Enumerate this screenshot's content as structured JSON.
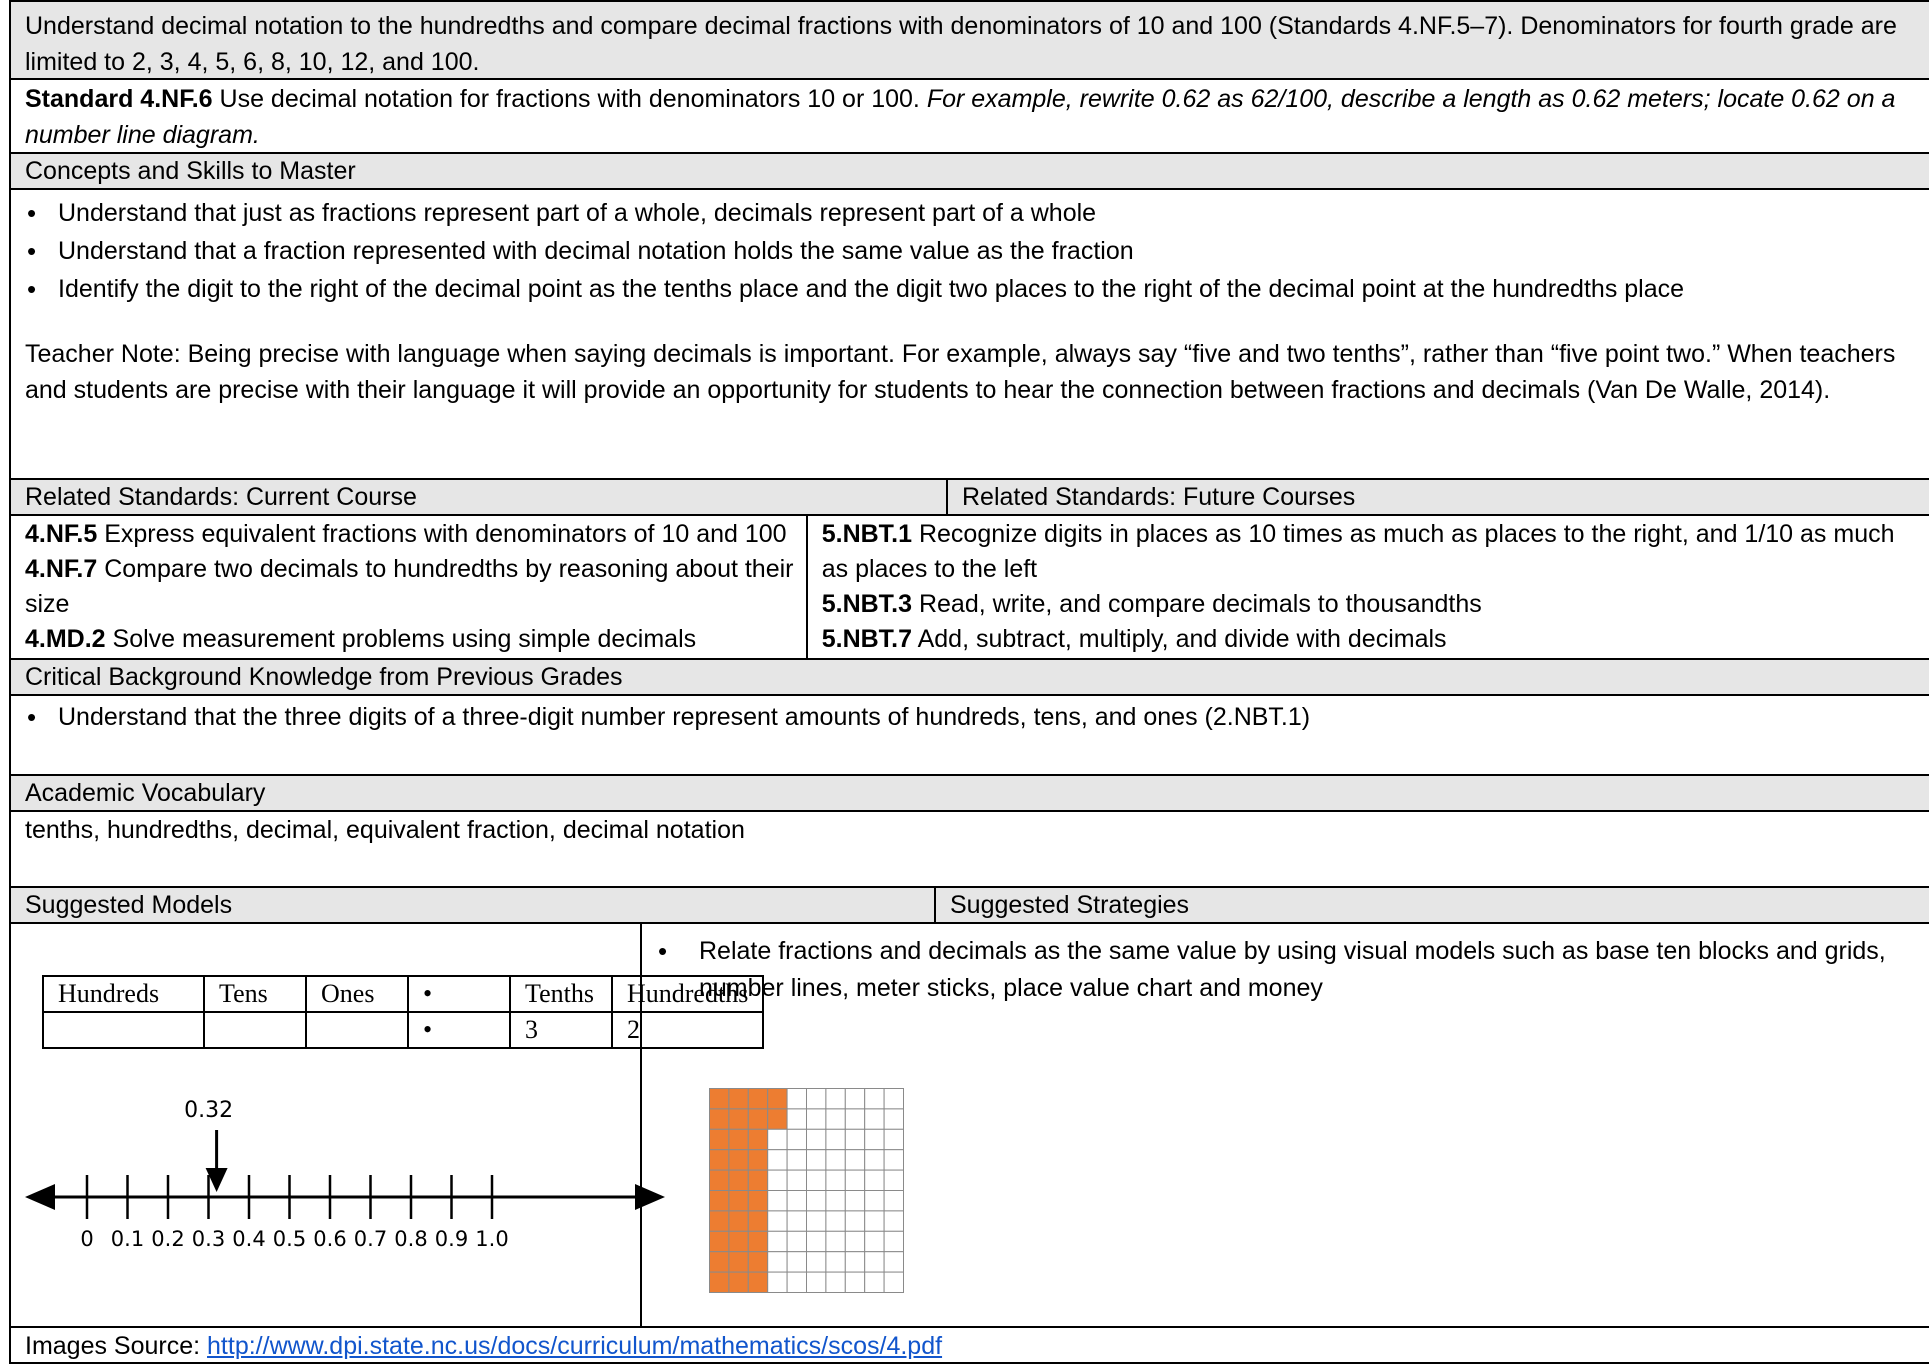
{
  "intro": "Understand decimal notation to the hundredths and compare decimal fractions with denominators of 10 and 100 (Standards 4.NF.5–7). Denominators for fourth grade are limited to 2, 3, 4, 5, 6, 8, 10, 12, and 100.",
  "standard": {
    "code": "Standard 4.NF.6",
    "text": " Use decimal notation for fractions with denominators 10 or 100. ",
    "example": "For example, rewrite 0.62 as 62/100, describe a length as 0.62 meters; locate 0.62 on a number line diagram."
  },
  "concepts": {
    "heading": "Concepts and Skills to Master",
    "bullets": [
      "Understand that just as fractions represent part of a whole, decimals represent part of a whole",
      "Understand that a fraction represented with decimal notation holds the same value as the fraction",
      "Identify the digit to the right of the decimal point as the tenths place and the digit two places to the right of the decimal point at the hundredths place"
    ],
    "teacher_note": "Teacher Note: Being precise with language when saying decimals is important. For example, always say “five and two tenths”, rather than “five point two.” When teachers and students are precise with their language it will provide an opportunity for students to hear the connection between fractions and decimals (Van De Walle, 2014)."
  },
  "related": {
    "current_heading": "Related Standards: Current Course",
    "future_heading": "Related Standards: Future Courses",
    "current": [
      {
        "code": "4.NF.5",
        "text": " Express equivalent fractions with denominators of 10 and 100"
      },
      {
        "code": "4.NF.7",
        "text": " Compare two decimals to hundredths by reasoning about their size"
      },
      {
        "code": "4.MD.2",
        "text": " Solve measurement problems using simple decimals"
      }
    ],
    "future": [
      {
        "code": "5.NBT.1",
        "text": "  Recognize digits in places as 10 times as much as places to the right, and 1/10 as much as places to the left"
      },
      {
        "code": "5.NBT.3",
        "text": "  Read, write, and compare decimals to thousandths"
      },
      {
        "code": "5.NBT.7",
        "text": "  Add, subtract, multiply, and divide with decimals"
      }
    ]
  },
  "background": {
    "heading": "Critical Background Knowledge from Previous Grades",
    "bullets": [
      "Understand that the three digits of a three-digit number represent amounts of hundreds, tens, and ones (2.NBT.1)"
    ]
  },
  "vocab": {
    "heading": "Academic Vocabulary",
    "text": "tenths, hundredths, decimal, equivalent fraction, decimal notation"
  },
  "models": {
    "heading": "Suggested Models",
    "place_value": {
      "headers": [
        "Hundreds",
        "Tens",
        "Ones",
        "•",
        "Tenths",
        "Hundredths"
      ],
      "values": [
        "",
        "",
        "",
        "•",
        "3",
        "2"
      ]
    },
    "number_line": {
      "pointer_label": "0.32",
      "pointer_value": 0.32,
      "ticks": [
        "0",
        "0.1",
        "0.2",
        "0.3",
        "0.4",
        "0.5",
        "0.6",
        "0.7",
        "0.8",
        "0.9",
        "1.0"
      ]
    },
    "grid": {
      "rows": 10,
      "cols": 10,
      "shaded": 32,
      "shade_color": "#ed7d31"
    }
  },
  "strategies": {
    "heading": "Suggested Strategies",
    "bullets": [
      "Relate fractions and decimals as the same value by using visual models such as base ten blocks and grids, number lines, meter sticks, place value chart and money"
    ]
  },
  "source": {
    "label": "Images Source: ",
    "url": "http://www.dpi.state.nc.us/docs/curriculum/mathematics/scos/4.pdf"
  }
}
